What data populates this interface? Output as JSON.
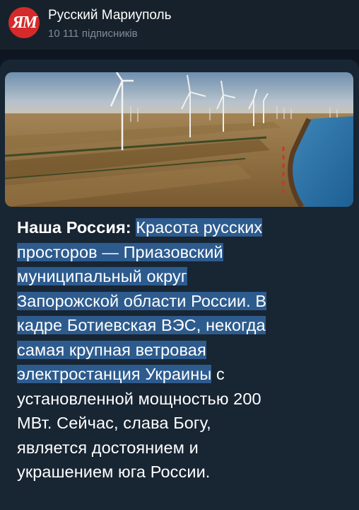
{
  "header": {
    "avatar_text": "ЯМ",
    "title": "Русский Мариуполь",
    "subscribers": "10 111 підписників"
  },
  "post": {
    "bold": "Наша Россия:",
    "lines_highlighted": [
      "Красота русских",
      "просторов — Приазовский",
      "муниципальный округ",
      "Запорожской области России. В",
      "кадре Ботиевская ВЭС, некогда",
      "самая крупная ветровая",
      "электростанция Украины"
    ],
    "after_highlight": " с",
    "lines_plain": [
      "установленной мощностью 200",
      "МВт. Сейчас, слава Богу,",
      "является достоянием и",
      "украшением юга России."
    ]
  },
  "colors": {
    "background": "#0e1621",
    "header": "#17212b",
    "bubble": "#182533",
    "highlight": "#2d5b8e",
    "avatar": "#d62a2a"
  }
}
